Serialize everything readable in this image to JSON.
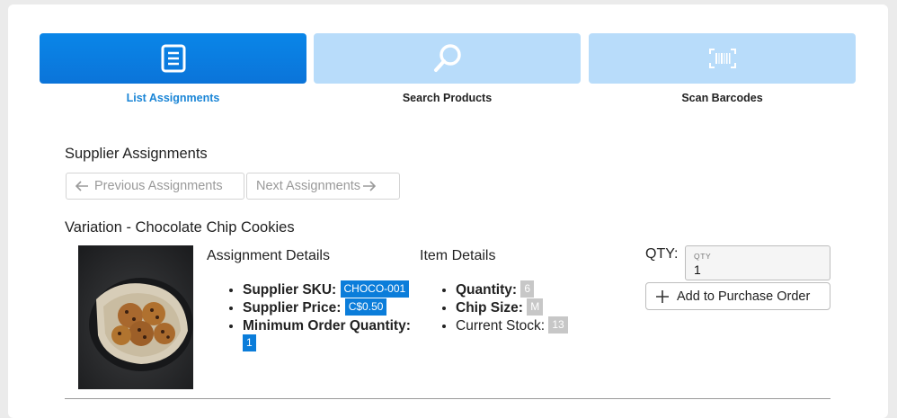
{
  "tabs": [
    {
      "label": "List Assignments",
      "icon": "document-list-icon",
      "active": true
    },
    {
      "label": "Search Products",
      "icon": "magnifier-icon",
      "active": false
    },
    {
      "label": "Scan Barcodes",
      "icon": "barcode-scan-icon",
      "active": false
    }
  ],
  "section_title": "Supplier Assignments",
  "pager": {
    "previous": "Previous Assignments",
    "next": "Next Assignments"
  },
  "variation_title": "Variation - Chocolate Chip Cookies",
  "assignment": {
    "title": "Assignment Details",
    "sku_label": "Supplier SKU:",
    "sku": "CHOCO-001",
    "price_label": "Supplier Price:",
    "price": "C$0.50",
    "moq_label": "Minimum Order Quantity:",
    "moq": "1"
  },
  "item": {
    "title": "Item Details",
    "quantity_label": "Quantity:",
    "quantity": "6",
    "chip_label": "Chip Size:",
    "chip": "M",
    "stock_label": "Current Stock:",
    "stock": "13"
  },
  "order": {
    "qty_label": "QTY:",
    "qty_caption": "QTY",
    "qty_value": "1",
    "add_label": "Add to Purchase Order"
  },
  "colors": {
    "accent": "#0b7dda",
    "tab_inactive": "#b8dcfa",
    "badge_grey": "#c7c7c7"
  }
}
